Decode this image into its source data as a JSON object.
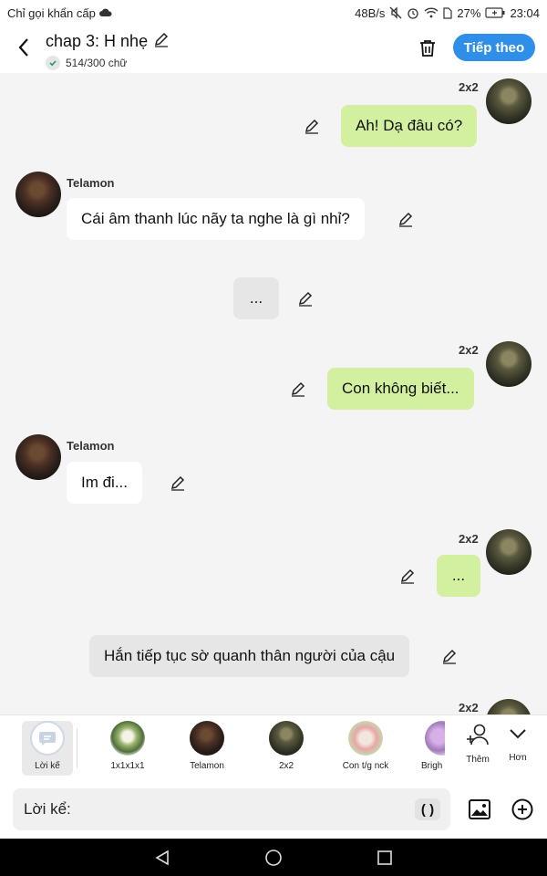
{
  "status_bar": {
    "left_text": "Chỉ gọi khẩn cấp",
    "speed": "48B/s",
    "battery": "27%",
    "time": "23:04"
  },
  "header": {
    "title": "chap 3: H nhẹ",
    "word_count": "514/300 chữ",
    "next_label": "Tiếp theo"
  },
  "messages": [
    {
      "sender": "2x2",
      "text": "Ah! Dạ đâu có?"
    },
    {
      "sender": "Telamon",
      "text": "Cái âm thanh lúc nãy ta nghe là gì nhỉ?"
    },
    {
      "sender": "",
      "text": "..."
    },
    {
      "sender": "2x2",
      "text": "Con không biết..."
    },
    {
      "sender": "Telamon",
      "text": "Im đi..."
    },
    {
      "sender": "2x2",
      "text": "..."
    },
    {
      "sender": "",
      "text": "Hắn tiếp tục sờ quanh thân người của cậu"
    },
    {
      "sender": "2x2",
      "text": ""
    }
  ],
  "characters": [
    {
      "label": "Lời kể",
      "selected": true
    },
    {
      "label": "1x1x1x1"
    },
    {
      "label": "Telamon"
    },
    {
      "label": "2x2"
    },
    {
      "label": "Con t/g nck"
    },
    {
      "label": "Brigh"
    }
  ],
  "tools": {
    "add_label": "Thêm",
    "more_label": "Hơn"
  },
  "input": {
    "prefix": "Lời kể:",
    "paren": "( )"
  },
  "colors": {
    "accent": "#2f8fe8",
    "my_bubble": "#d3f0a0"
  }
}
